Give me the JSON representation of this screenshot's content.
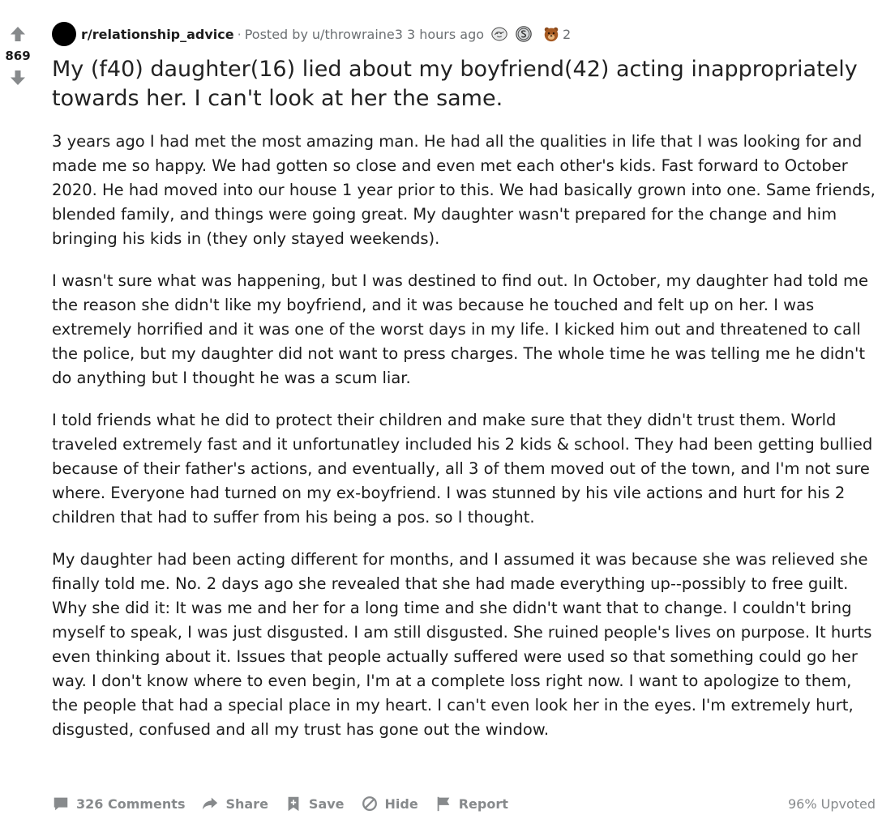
{
  "vote": {
    "score": "869"
  },
  "post": {
    "subreddit": "r/relationship_advice",
    "separator": "·",
    "posted_by": "Posted by",
    "author": "u/throwraine3",
    "age": "3 hours ago",
    "awards": [
      {
        "icon": "silver-award-icon"
      },
      {
        "icon": "s-coin-award-icon"
      },
      {
        "icon": "bear-award-icon",
        "count": "2"
      }
    ],
    "title": "My (f40) daughter(16) lied about my boyfriend(42) acting inappropriately towards her. I can't look at her the same.",
    "body": [
      "3 years ago I had met the most amazing man. He had all the qualities in life that I was looking for and made me so happy. We had gotten so close and even met each other's kids. Fast forward to October 2020. He had moved into our house 1 year prior to this. We had basically grown into one. Same friends, blended family, and things were going great. My daughter wasn't prepared for the change and him bringing his kids in (they only stayed weekends).",
      "I wasn't sure what was happening, but I was destined to find out. In October, my daughter had told me the reason she didn't like my boyfriend, and it was because he touched and felt up on her. I was extremely horrified and it was one of the worst days in my life. I kicked him out and threatened to call the police, but my daughter did not want to press charges. The whole time he was telling me he didn't do anything but I thought he was a scum liar.",
      "I told friends what he did to protect their children and make sure that they didn't trust them. World traveled extremely fast and it unfortunatley included his 2 kids & school. They had been getting bullied because of their father's actions, and eventually, all 3 of them moved out of the town, and I'm not sure where. Everyone had turned on my ex-boyfriend. I was stunned by his vile actions and hurt for his 2 children that had to suffer from his being a pos. so I thought.",
      "My daughter had been acting different for months, and I assumed it was because she was relieved she finally told me. No. 2 days ago she revealed that she had made everything up--possibly to free guilt. Why she did it: It was me and her for a long time and she didn't want that to change. I couldn't bring myself to speak, I was just disgusted. I am still disgusted. She ruined people's lives on purpose. It hurts even thinking about it. Issues that people actually suffered were used so that something could go her way. I don't know where to even begin, I'm at a complete loss right now. I want to apologize to them, the people that had a special place in my heart. I can't even look her in the eyes. I'm extremely hurt, disgusted, confused and all my trust has gone out the window."
    ]
  },
  "actions": {
    "comments": "326 Comments",
    "share": "Share",
    "save": "Save",
    "hide": "Hide",
    "report": "Report",
    "upvoted": "96% Upvoted"
  },
  "colors": {
    "icon_gray": "#878a8c",
    "text": "#1c1c1c",
    "meta": "#6b6f72"
  }
}
